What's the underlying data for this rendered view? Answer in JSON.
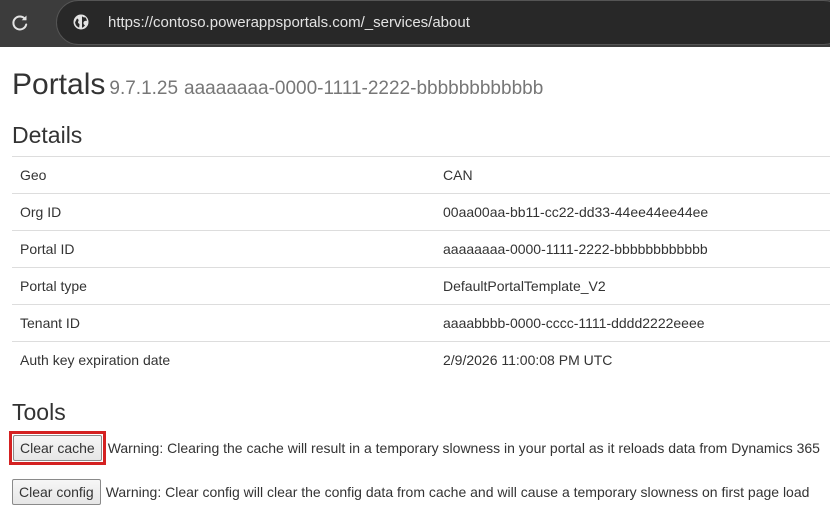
{
  "browser": {
    "url": "https://contoso.powerappsportals.com/_services/about",
    "icons": {
      "reload": "reload-icon",
      "site_info": "site-info-icon"
    }
  },
  "header": {
    "title": "Portals",
    "version": "9.7.1.25",
    "portal_id": "aaaaaaaa-0000-1111-2222-bbbbbbbbbbbb"
  },
  "details": {
    "heading": "Details",
    "rows": [
      {
        "key": "Geo",
        "value": "CAN"
      },
      {
        "key": "Org ID",
        "value": "00aa00aa-bb11-cc22-dd33-44ee44ee44ee"
      },
      {
        "key": "Portal ID",
        "value": "aaaaaaaa-0000-1111-2222-bbbbbbbbbbbb"
      },
      {
        "key": "Portal type",
        "value": "DefaultPortalTemplate_V2"
      },
      {
        "key": "Tenant ID",
        "value": "aaaabbbb-0000-cccc-1111-dddd2222eeee"
      },
      {
        "key": "Auth key expiration date",
        "value": "2/9/2026 11:00:08 PM UTC"
      }
    ]
  },
  "tools": {
    "heading": "Tools",
    "clear_cache": {
      "label": "Clear cache",
      "warning": "Warning: Clearing the cache will result in a temporary slowness in your portal as it reloads data from Dynamics 365",
      "highlighted": true,
      "highlight_color": "#d42121"
    },
    "clear_config": {
      "label": "Clear config",
      "warning": "Warning: Clear config will clear the config data from cache and will cause a temporary slowness on first page load"
    }
  },
  "colors": {
    "browser_bar": "#3c3c3c",
    "omnibox": "#282828",
    "url_text": "#e3e3e3",
    "muted_text": "#777777",
    "border": "#dddddd"
  }
}
